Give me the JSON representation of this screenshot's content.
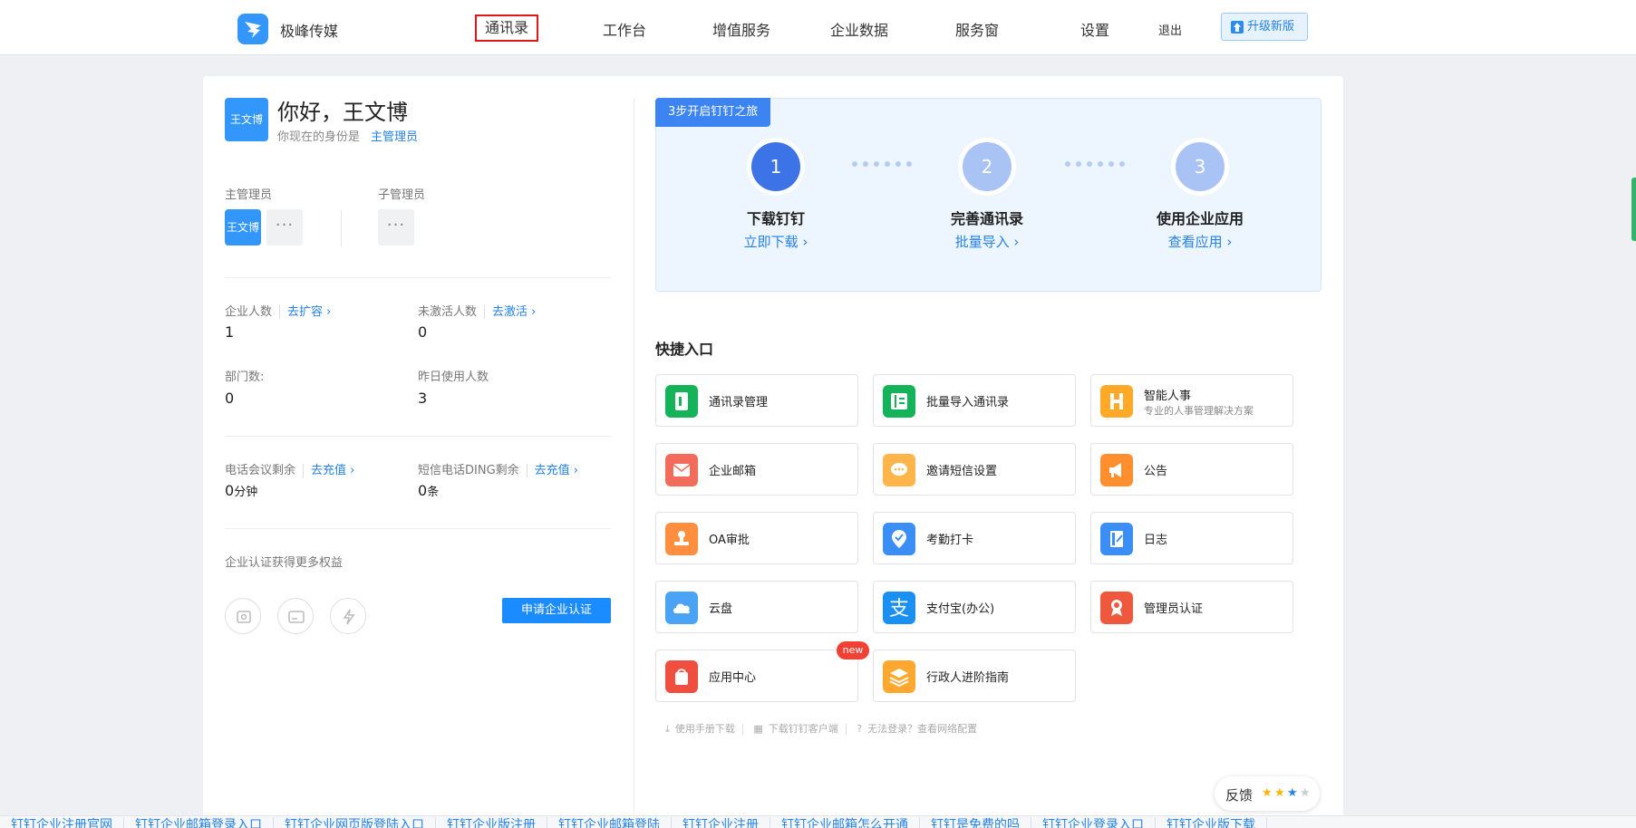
{
  "header": {
    "brand": "极峰传媒",
    "nav": [
      "通讯录",
      "工作台",
      "增值服务",
      "企业数据",
      "服务窗",
      "设置"
    ],
    "logout": "退出",
    "upgrade": "升级新版"
  },
  "profile": {
    "avatar_text": "王文博",
    "greeting": "你好，王文博",
    "identity_prefix": "你现在的身份是",
    "identity_role": "主管理员"
  },
  "admins": {
    "main_label": "主管理员",
    "main_avatar": "王文博",
    "sub_label": "子管理员",
    "more": "···"
  },
  "stats": [
    {
      "label": "企业人数",
      "link": "去扩容 ›",
      "value": "1",
      "unit": ""
    },
    {
      "label": "未激活人数",
      "link": "去激活 ›",
      "value": "0",
      "unit": ""
    },
    {
      "label": "部门数:",
      "link": "",
      "value": "0",
      "unit": ""
    },
    {
      "label": "昨日使用人数",
      "link": "",
      "value": "3",
      "unit": ""
    },
    {
      "label": "电话会议剩余",
      "link": "去充值 ›",
      "value": "0",
      "unit": "分钟"
    },
    {
      "label": "短信电话DING剩余",
      "link": "去充值 ›",
      "value": "0",
      "unit": "条"
    }
  ],
  "certification": {
    "text": "企业认证获得更多权益",
    "button": "申请企业认证"
  },
  "guide": {
    "tag": "3步开启钉钉之旅",
    "steps": [
      {
        "num": "1",
        "title": "下载钉钉",
        "link": "立即下载 ›"
      },
      {
        "num": "2",
        "title": "完善通讯录",
        "link": "批量导入 ›"
      },
      {
        "num": "3",
        "title": "使用企业应用",
        "link": "查看应用 ›"
      }
    ]
  },
  "quick": {
    "title": "快捷入口",
    "new_badge": "new",
    "items": [
      {
        "label": "通讯录管理",
        "sub": "",
        "icon": "contacts-icon",
        "color": "#14b35a"
      },
      {
        "label": "批量导入通讯录",
        "sub": "",
        "icon": "import-contacts-icon",
        "color": "#14b35a"
      },
      {
        "label": "智能人事",
        "sub": "专业的人事管理解决方案",
        "icon": "hr-icon",
        "color": "#ffa928"
      },
      {
        "label": "企业邮箱",
        "sub": "",
        "icon": "mail-icon",
        "color": "#f26c5b"
      },
      {
        "label": "邀请短信设置",
        "sub": "",
        "icon": "sms-icon",
        "color": "#ffb54a"
      },
      {
        "label": "公告",
        "sub": "",
        "icon": "announcement-icon",
        "color": "#ff8f2e"
      },
      {
        "label": "OA审批",
        "sub": "",
        "icon": "approval-icon",
        "color": "#ff8f3e"
      },
      {
        "label": "考勤打卡",
        "sub": "",
        "icon": "attendance-icon",
        "color": "#3a8ef5"
      },
      {
        "label": "日志",
        "sub": "",
        "icon": "log-icon",
        "color": "#3a8ef5"
      },
      {
        "label": "云盘",
        "sub": "",
        "icon": "cloud-icon",
        "color": "#4aa3f5"
      },
      {
        "label": "支付宝(办公)",
        "sub": "",
        "icon": "alipay-icon",
        "color": "#1a90f2"
      },
      {
        "label": "管理员认证",
        "sub": "",
        "icon": "admin-cert-icon",
        "color": "#f0583e"
      },
      {
        "label": "应用中心",
        "sub": "",
        "icon": "app-center-icon",
        "color": "#f04e3e"
      },
      {
        "label": "行政人进阶指南",
        "sub": "",
        "icon": "guide-book-icon",
        "color": "#ffa830"
      }
    ]
  },
  "footer_links": [
    "使用手册下载",
    "下载钉钉客户端",
    "无法登录？查看网络配置"
  ],
  "feedback": {
    "label": "反馈"
  },
  "bottom_strip": [
    "钉钉企业注册官网",
    "钉钉企业邮箱登录入口",
    "钉钉企业网页版登陆入口",
    "钉钉企业版注册",
    "钉钉企业邮箱登陆",
    "钉钉企业注册",
    "钉钉企业邮箱怎么开通",
    "钉钉是免费的吗",
    "钉钉企业登录入口",
    "钉钉企业版下载"
  ]
}
